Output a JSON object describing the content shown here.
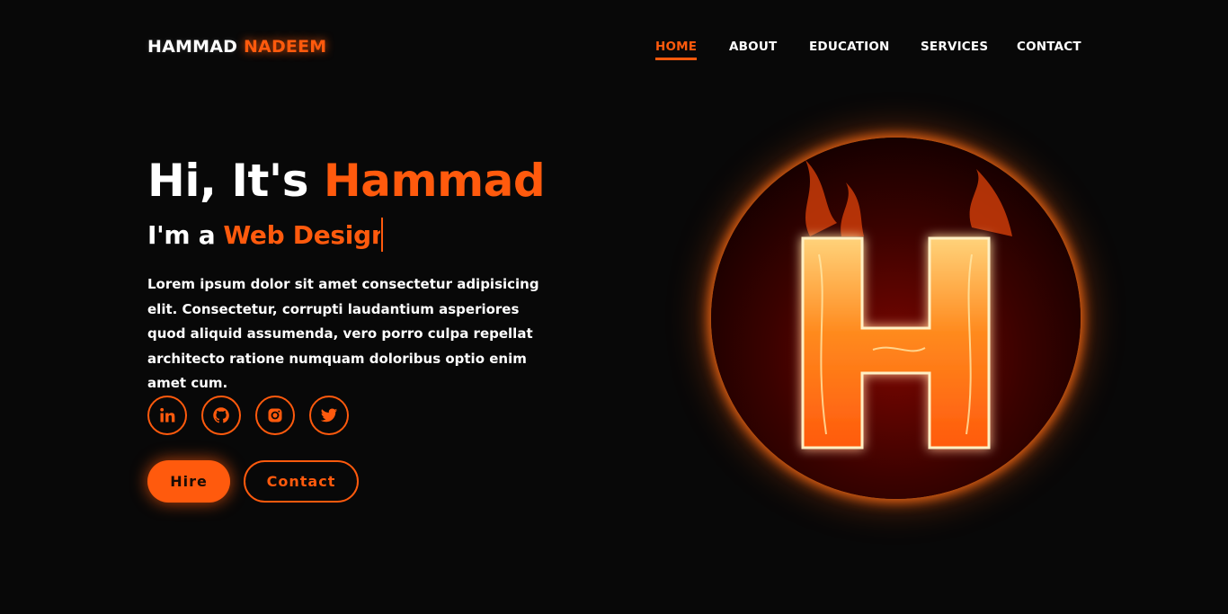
{
  "brand": {
    "first": "HAMMAD",
    "last": "NADEEM"
  },
  "nav": [
    {
      "label": "HOME",
      "active": true
    },
    {
      "label": "ABOUT"
    },
    {
      "label": "EDUCATION"
    },
    {
      "label": "SERVICES"
    },
    {
      "label": "CONTACT"
    }
  ],
  "hero": {
    "greeting": "Hi, It's",
    "name": "Hammad",
    "role_prefix": "I'm a",
    "role_typed": "Web Designe",
    "description": "Lorem ipsum dolor sit amet consectetur adipisicing elit. Consectetur, corrupti laudantium asperiores quod aliquid assumenda, vero porro culpa repellat architecto ratione numquam doloribus optio enim amet cum.",
    "socials": [
      {
        "icon": "linkedin-icon"
      },
      {
        "icon": "github-icon"
      },
      {
        "icon": "instagram-icon"
      },
      {
        "icon": "twitter-icon"
      }
    ],
    "buttons": {
      "hire": "Hire",
      "contact": "Contact"
    },
    "image_letter": "H"
  },
  "colors": {
    "accent": "#ff5a0d",
    "background": "#080808",
    "text": "#ffffff"
  }
}
